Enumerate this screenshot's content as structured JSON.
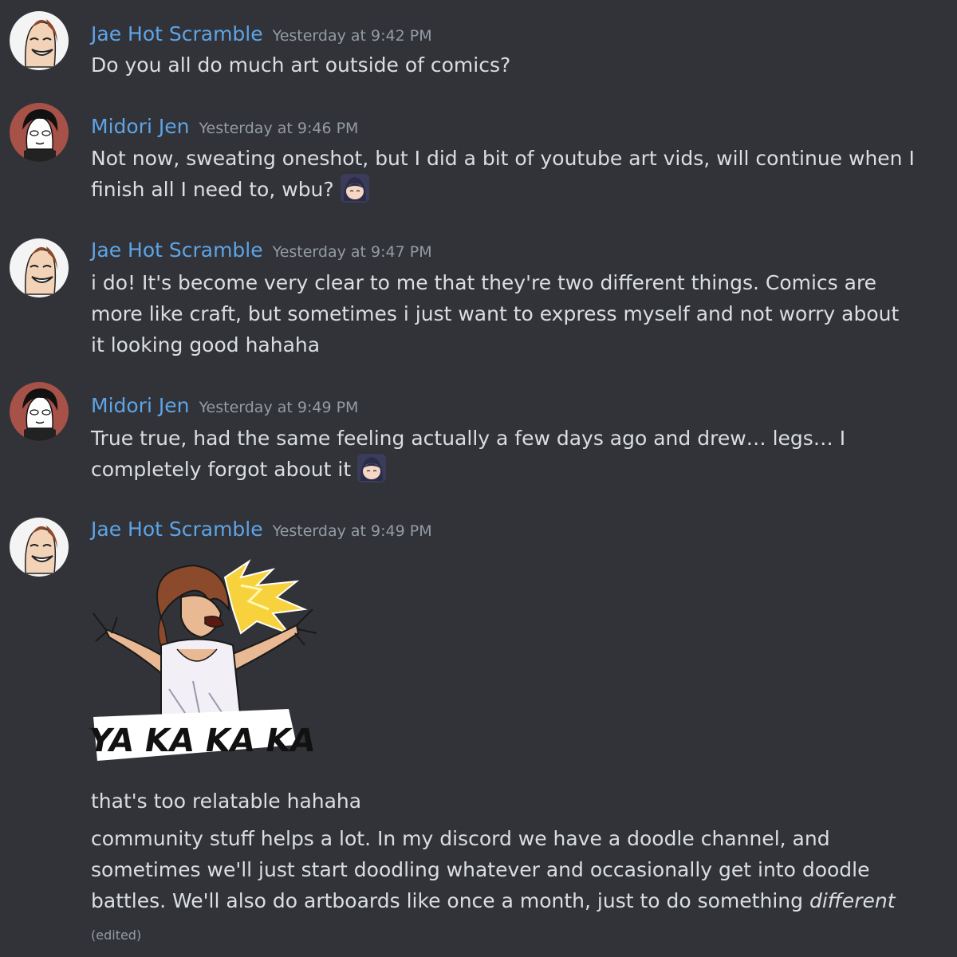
{
  "messages": [
    {
      "user": "Jae Hot Scramble",
      "time": "Yesterday at 9:42 PM",
      "lines": [
        "Do you all do much art outside of comics?"
      ]
    },
    {
      "user": "Midori Jen",
      "time": "Yesterday at 9:46 PM",
      "lines": [
        "Not now, sweating oneshot, but I did a bit of youtube art vids, will continue when I",
        "finish all I need to, wbu?"
      ]
    },
    {
      "user": "Jae Hot Scramble",
      "time": "Yesterday at 9:47 PM",
      "lines": [
        "i do! It's become very clear to me that they're two different things. Comics are",
        "more like craft, but sometimes i just want to express myself and not worry about",
        "it looking good hahaha"
      ]
    },
    {
      "user": "Midori Jen",
      "time": "Yesterday at 9:49 PM",
      "lines": [
        "True true, had the same feeling actually a few days ago and drew… legs… I",
        "completely forgot about it"
      ]
    },
    {
      "user": "Jae Hot Scramble",
      "time": "Yesterday at 9:49 PM",
      "sticker_text": "KYA KA KA KA",
      "lines": [
        "that's too relatable hahaha",
        "community stuff helps a lot. In my discord we have a doodle channel, and",
        "sometimes we'll just start doodling whatever and occasionally get into doodle",
        "battles. We'll also do artboards like once a month, just to do something "
      ],
      "italic_word": "different",
      "edited": "(edited)"
    }
  ],
  "colors": {
    "background": "#313338",
    "username": "#5ea4e6",
    "timestamp": "#949ba4",
    "text": "#dbdee1"
  },
  "icons": {
    "avatar_jae": "avatar-jae-icon",
    "avatar_midori": "avatar-midori-icon",
    "emoji": "custom-emoji-icon"
  }
}
